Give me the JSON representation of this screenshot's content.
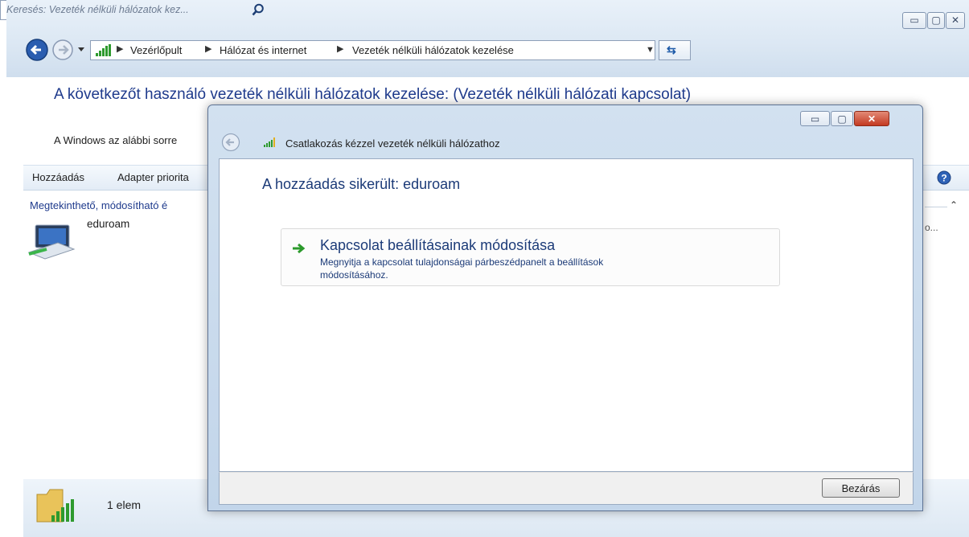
{
  "explorer": {
    "breadcrumbs": [
      "Vezérlőpult",
      "Hálózat és internet",
      "Vezeték nélküli hálózatok kezelése"
    ],
    "search_placeholder": "Keresés: Vezeték nélküli hálózatok kez...",
    "heading": "A következőt használó vezeték nélküli hálózatok kezelése: (Vezeték nélküli hálózati kapcsolat)",
    "subtext": "A Windows az alábbi sorre",
    "toolbar": {
      "add": "Hozzáadás",
      "adapter": "Adapter priorita"
    },
    "group_header": "Megtekinthető, módosítható é",
    "network_name": "eduroam",
    "truncated_col": "o...",
    "status_count": "1 elem"
  },
  "dialog": {
    "title": "Csatlakozás kézzel vezeték nélküli hálózathoz",
    "success": "A hozzáadás sikerült: eduroam",
    "command_title": "Kapcsolat beállításainak módosítása",
    "command_desc_1": "Megnyitja a kapcsolat tulajdonságai párbeszédpanelt a beállítások",
    "command_desc_2": "módosításához.",
    "close_button": "Bezárás"
  },
  "icons": [
    "back-icon",
    "forward-icon",
    "dropdown-icon",
    "signal-icon",
    "refresh-icon",
    "search-icon",
    "help-icon",
    "network-icon",
    "folder-signal-icon",
    "arrow-right-icon",
    "close-icon"
  ],
  "colors": {
    "heading": "#1e3a8c",
    "dialog_heading": "#1c3b78",
    "close_red": "#c9402c",
    "arrow_green": "#2c9a2c"
  }
}
